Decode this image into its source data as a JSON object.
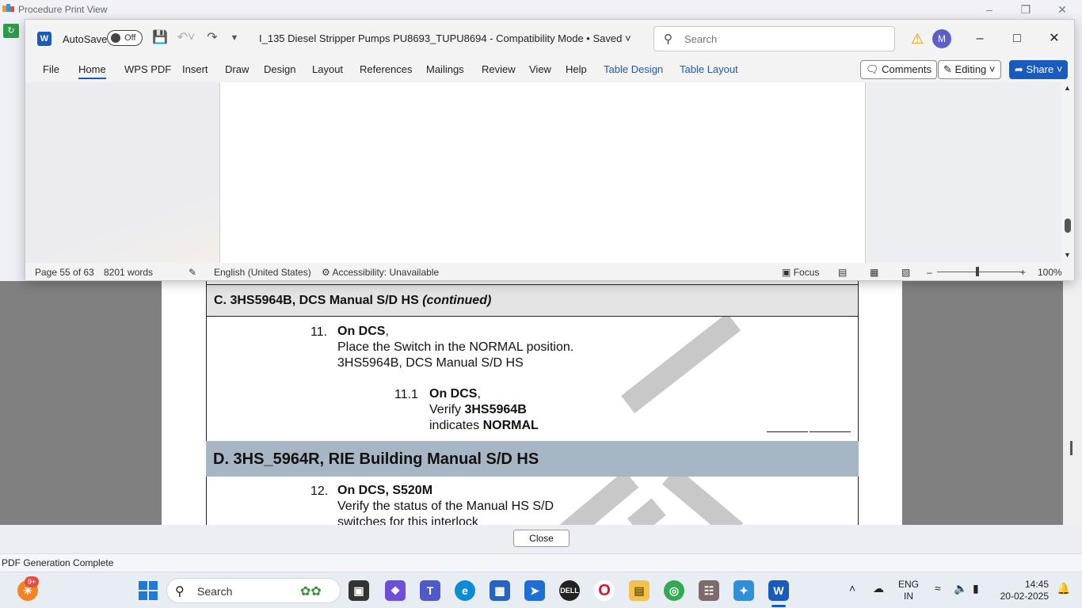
{
  "ppv": {
    "title": "Procedure Print View",
    "close_label": "Close",
    "status": "PDF Generation Complete"
  },
  "document": {
    "section_c_title": "C.  3HS5964B, DCS Manual S/D HS",
    "section_c_suffix": "(continued)",
    "step11": {
      "num": "11.",
      "line1_bold": "On DCS",
      "line1_rest": ",",
      "line2": "Place the Switch in the NORMAL position.",
      "line3": "3HS5964B, DCS Manual S/D HS"
    },
    "step11_1": {
      "num": "11.1",
      "line1_bold": "On DCS",
      "line1_rest": ",",
      "line2_pre": "Verify ",
      "line2_bold": "3HS5964B",
      "line3_pre": "indicates ",
      "line3_bold": "NORMAL"
    },
    "section_d_title": "D.  3HS_5964R, RIE Building Manual S/D HS",
    "step12": {
      "num": "12.",
      "line1_bold": "On DCS, S520M",
      "line2": "Verify the status of the Manual HS S/D",
      "line3": "switches for this interlock"
    }
  },
  "word": {
    "autosave_label": "AutoSave",
    "autosave_state": "Off",
    "doc_title": "I_135 Diesel Stripper Pumps PU8693_TUPU8694  -  Compatibility Mode • Saved",
    "search_placeholder": "Search",
    "avatar_initial": "M",
    "tabs": [
      "File",
      "Home",
      "WPS PDF",
      "Insert",
      "Draw",
      "Design",
      "Layout",
      "References",
      "Mailings",
      "Review",
      "View",
      "Help",
      "Table Design",
      "Table Layout"
    ],
    "comments_label": "Comments",
    "editing_label": "Editing",
    "share_label": "Share",
    "status": {
      "page": "Page 55 of 63",
      "words": "8201 words",
      "language": "English (United States)",
      "accessibility": "Accessibility: Unavailable",
      "focus": "Focus",
      "zoom": "100%"
    }
  },
  "taskbar": {
    "search_label": "Search",
    "notif_badge": "9+",
    "lang_line1": "ENG",
    "lang_line2": "IN",
    "time": "14:45",
    "date": "20-02-2025"
  }
}
